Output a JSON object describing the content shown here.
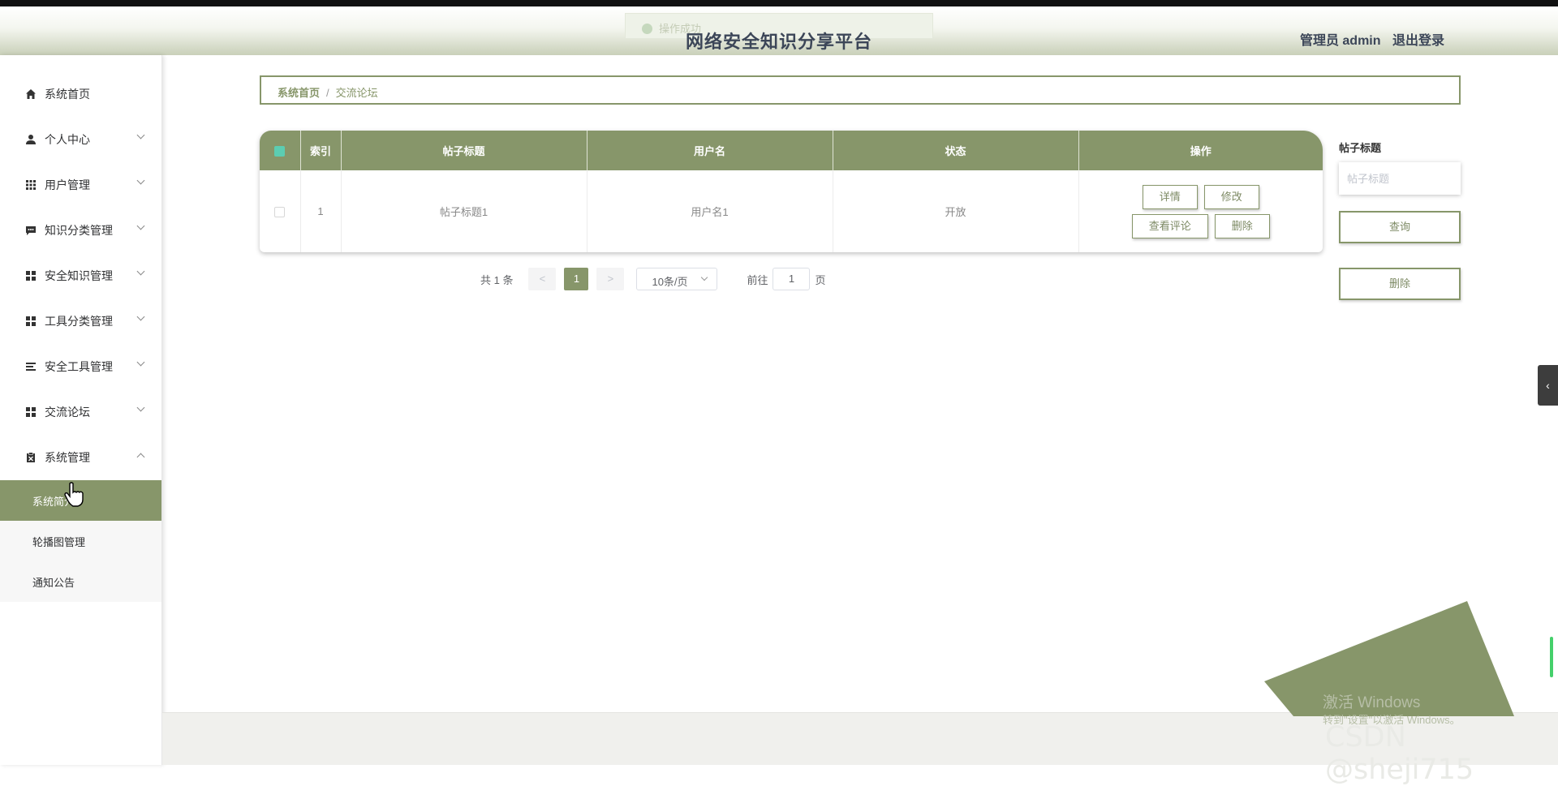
{
  "header": {
    "toast_text": "操作成功",
    "site_title": "网络安全知识分享平台",
    "user_label": "管理员 admin",
    "logout_label": "退出登录"
  },
  "sidebar": {
    "items": [
      {
        "label": "系统首页",
        "icon": "home-icon"
      },
      {
        "label": "个人中心",
        "icon": "user-icon"
      },
      {
        "label": "用户管理",
        "icon": "grid-icon"
      },
      {
        "label": "知识分类管理",
        "icon": "chat-icon"
      },
      {
        "label": "安全知识管理",
        "icon": "apps-icon"
      },
      {
        "label": "工具分类管理",
        "icon": "apps-icon"
      },
      {
        "label": "安全工具管理",
        "icon": "list-icon"
      },
      {
        "label": "交流论坛",
        "icon": "apps-icon"
      },
      {
        "label": "系统管理",
        "icon": "clipboard-icon"
      }
    ],
    "sub_items": [
      {
        "label": "系统简介"
      },
      {
        "label": "轮播图管理"
      },
      {
        "label": "通知公告"
      }
    ]
  },
  "breadcrumb": {
    "home": "系统首页",
    "separator": "/",
    "current": "交流论坛"
  },
  "table": {
    "columns": [
      "索引",
      "帖子标题",
      "用户名",
      "状态",
      "操作"
    ],
    "rows": [
      {
        "index": "1",
        "title": "帖子标题1",
        "username": "用户名1",
        "status": "开放"
      }
    ],
    "actions": {
      "detail": "详情",
      "edit": "修改",
      "comments": "查看评论",
      "delete": "删除"
    }
  },
  "pagination": {
    "total": "共 1 条",
    "prev": "<",
    "current_page": "1",
    "next": ">",
    "page_size": "10条/页",
    "goto_label": "前往",
    "goto_value": "1",
    "page_suffix": "页"
  },
  "search": {
    "label": "帖子标题",
    "placeholder": "帖子标题",
    "query_button": "查询",
    "delete_button": "删除"
  },
  "right_tab_glyph": "‹",
  "watermark": {
    "activate": "激活 Windows",
    "activate_sub": "转到\"设置\"以激活 Windows。",
    "csdn": "CSDN @sheji715"
  },
  "colors": {
    "accent": "#87966a",
    "checkbox_head": "#5ccdb2",
    "title_text": "#3c4658"
  }
}
